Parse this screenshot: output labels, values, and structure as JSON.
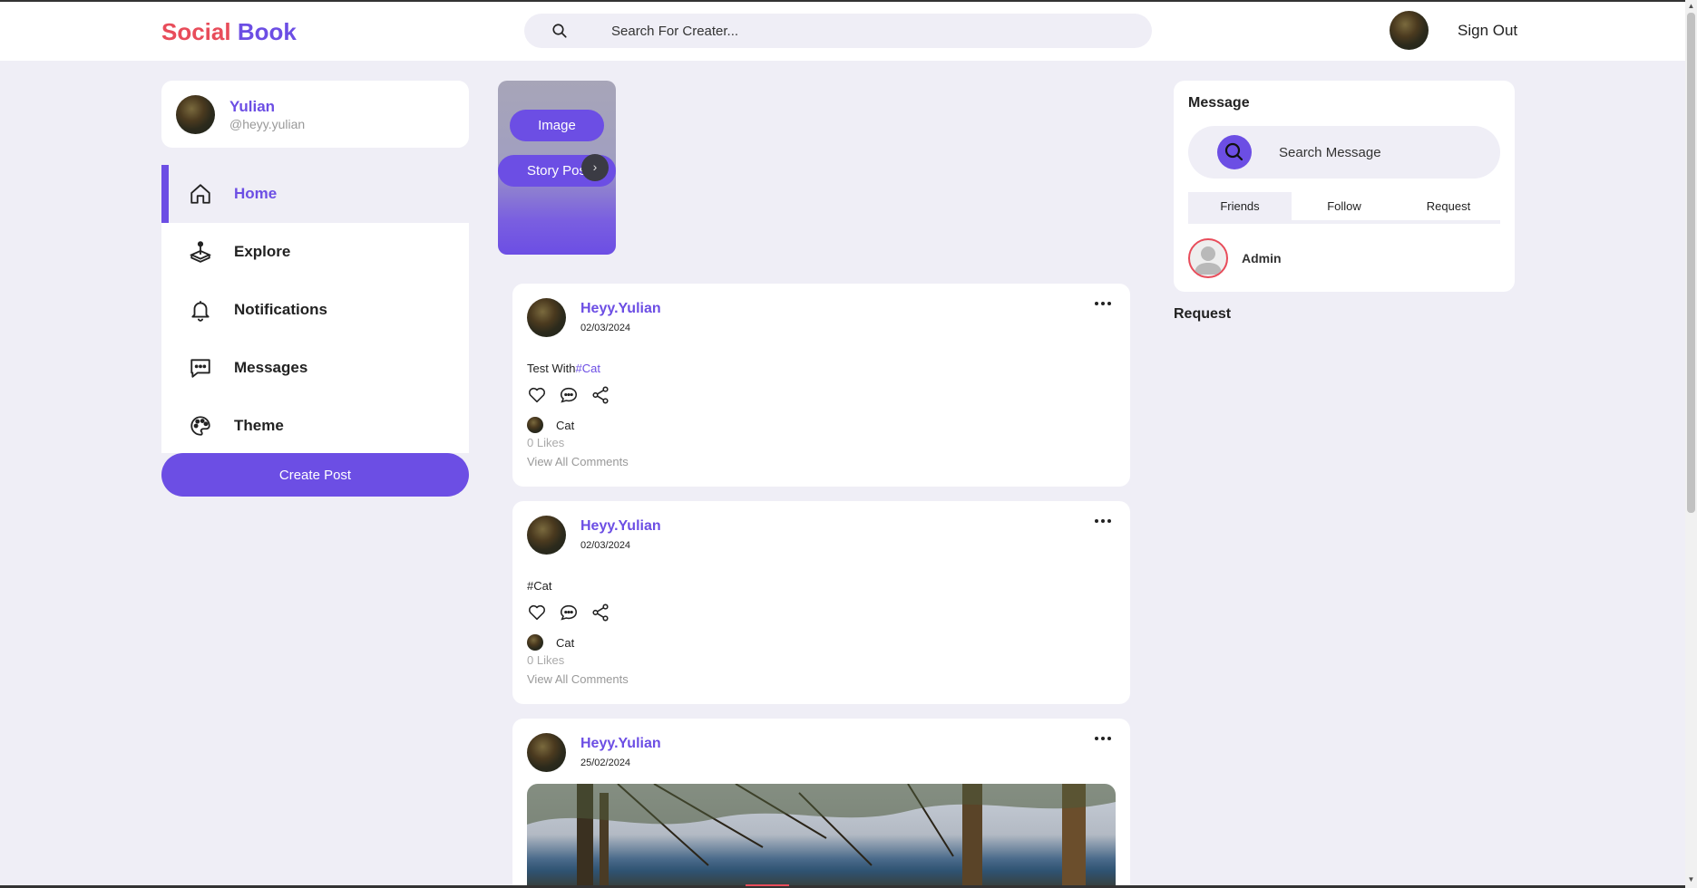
{
  "header": {
    "logo_part1": "Social",
    "logo_part2": "Book",
    "search_placeholder": "Search For Creater...",
    "signout_label": "Sign Out"
  },
  "profile": {
    "name": "Yulian",
    "handle": "@heyy.yulian"
  },
  "menu": {
    "items": [
      {
        "label": "Home",
        "icon": "home-icon",
        "active": true
      },
      {
        "label": "Explore",
        "icon": "explore-icon"
      },
      {
        "label": "Notifications",
        "icon": "bell-icon"
      },
      {
        "label": "Messages",
        "icon": "chat-icon"
      },
      {
        "label": "Theme",
        "icon": "palette-icon"
      }
    ],
    "create_post_label": "Create Post"
  },
  "story": {
    "image_label": "Image",
    "post_label": "Story Post",
    "arrow": "›"
  },
  "posts": [
    {
      "user": "Heyy.Yulian",
      "date": "02/03/2024",
      "text_prefix": "Test With",
      "text_tag": "#Cat",
      "liker": "Cat",
      "likes": "0 Likes",
      "view_comments": "View All Comments"
    },
    {
      "user": "Heyy.Yulian",
      "date": "02/03/2024",
      "text_prefix": "",
      "text_tag": "#Cat",
      "liker": "Cat",
      "likes": "0 Likes",
      "view_comments": "View All Comments"
    },
    {
      "user": "Heyy.Yulian",
      "date": "25/02/2024"
    }
  ],
  "messages": {
    "title": "Message",
    "search_placeholder": "Search Message",
    "tabs": [
      "Friends",
      "Follow",
      "Request"
    ],
    "active_tab": "Friends",
    "friends": [
      {
        "name": "Admin"
      }
    ]
  },
  "request_title": "Request",
  "colors": {
    "accent": "#6c4ee4",
    "logo_red": "#e84c5a",
    "background": "#efeef6"
  }
}
